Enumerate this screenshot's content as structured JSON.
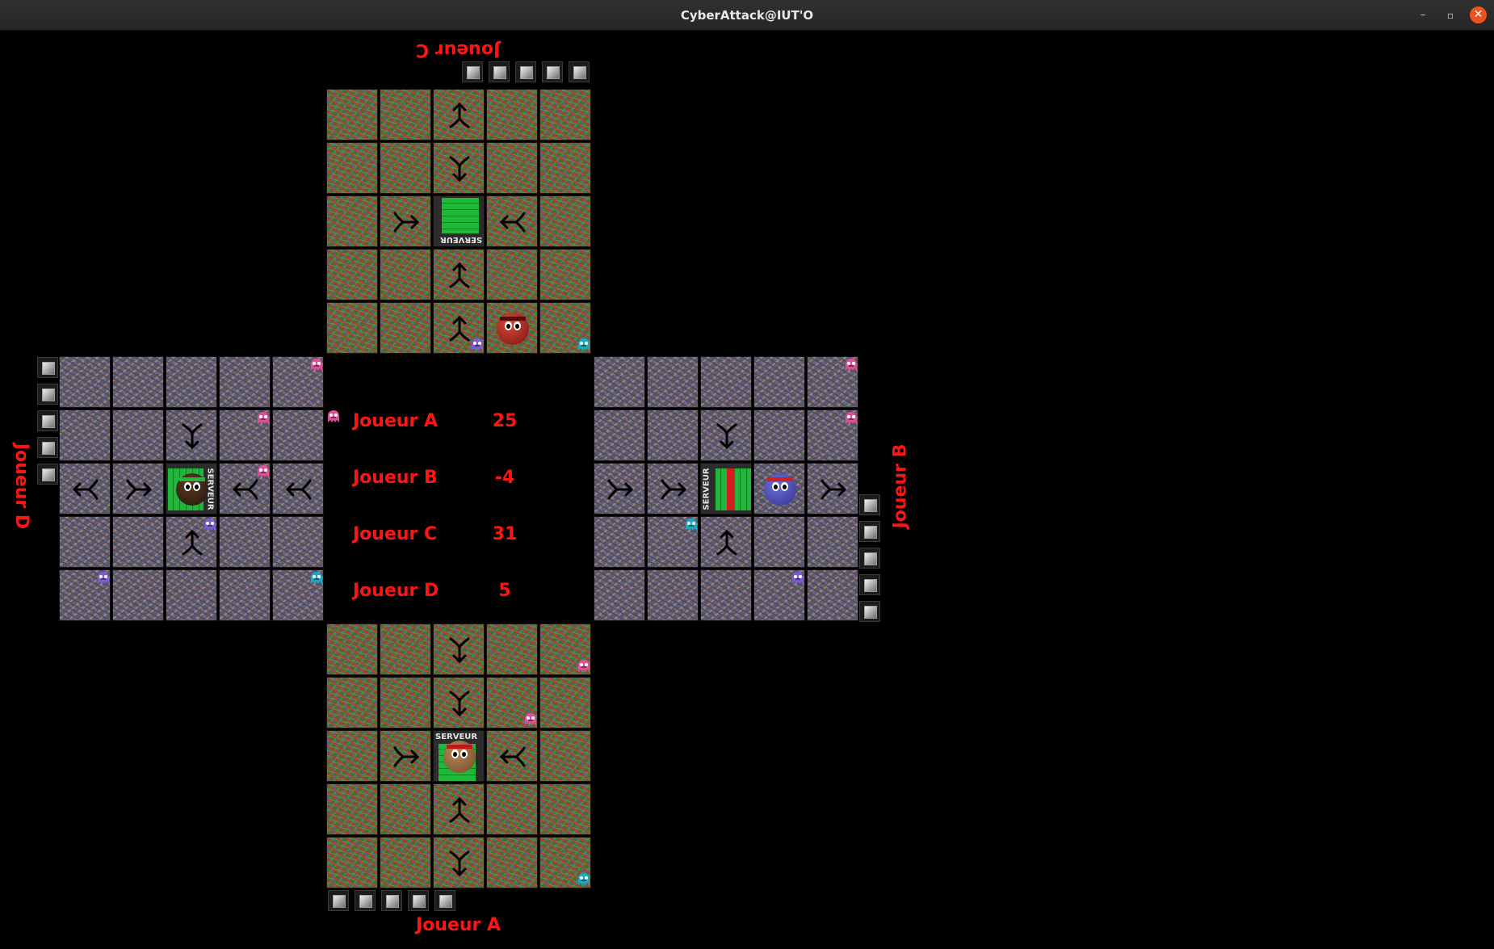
{
  "window": {
    "title": "CyberAttack@IUT'O",
    "controls": [
      "–",
      "▫",
      "✕"
    ]
  },
  "players": {
    "A": {
      "label": "Joueur A",
      "score": "25",
      "color": "#ff1414"
    },
    "B": {
      "label": "Joueur B",
      "score": "-4",
      "color": "#ff1414"
    },
    "C": {
      "label": "Joueur C",
      "score": "31",
      "color": "#ff1414"
    },
    "D": {
      "label": "Joueur D",
      "score": "5",
      "color": "#ff1414"
    }
  },
  "scoreboard": [
    {
      "name": "Joueur A",
      "score": "25"
    },
    {
      "name": "Joueur B",
      "score": "-4"
    },
    {
      "name": "Joueur C",
      "score": "31"
    },
    {
      "name": "Joueur D",
      "score": "5"
    }
  ],
  "server_caption": "SERVEUR",
  "colors": {
    "label_red": "#ff1414",
    "server_green": "#1fb83a",
    "server_red": "#d42020",
    "bug_pink": "#e0509a",
    "bug_purple": "#7d5ad6",
    "bug_cyan": "#1ba8c4",
    "close_button": "#e95420"
  },
  "boards": {
    "A": {
      "arrows": [
        [
          "-",
          "-",
          "down",
          "-",
          "-"
        ],
        [
          "-",
          "-",
          "down",
          "-",
          "-"
        ],
        [
          "-",
          "right",
          "server",
          "left",
          "-"
        ],
        [
          "-",
          "-",
          "up",
          "-",
          "-"
        ],
        [
          "-",
          "-",
          "down",
          "-",
          "-"
        ]
      ],
      "server_fill": "full",
      "pawn": "A",
      "bugs": [
        {
          "row": 0,
          "col": 4,
          "color": "pink"
        },
        {
          "row": 1,
          "col": 3,
          "color": "pink"
        },
        {
          "row": 4,
          "col": 4,
          "color": "cyan"
        }
      ],
      "slots": 5
    },
    "B": {
      "arrows": [
        [
          "-",
          "-",
          "-",
          "-",
          "-"
        ],
        [
          "-",
          "-",
          "down",
          "-",
          "-"
        ],
        [
          "right",
          "right",
          "server",
          "pawn",
          "right"
        ],
        [
          "-",
          "-",
          "up",
          "-",
          "-"
        ],
        [
          "-",
          "-",
          "-",
          "-",
          "-"
        ]
      ],
      "server_fill": "partial",
      "pawn": "B",
      "bugs": [
        {
          "row": 0,
          "col": 4,
          "color": "pink"
        },
        {
          "row": 1,
          "col": 4,
          "color": "pink"
        },
        {
          "row": 3,
          "col": 1,
          "color": "cyan"
        },
        {
          "row": 4,
          "col": 3,
          "color": "purple"
        }
      ],
      "slots": 5
    },
    "C": {
      "arrows": [
        [
          "-",
          "-",
          "up",
          "-",
          "-"
        ],
        [
          "-",
          "-",
          "down",
          "-",
          "-"
        ],
        [
          "-",
          "right",
          "server",
          "left",
          "-"
        ],
        [
          "-",
          "-",
          "up",
          "-",
          "-"
        ],
        [
          "-",
          "-",
          "up",
          "pawn",
          "-"
        ]
      ],
      "server_fill": "full",
      "pawn": "C",
      "bugs": [
        {
          "row": 4,
          "col": 2,
          "color": "purple"
        },
        {
          "row": 4,
          "col": 4,
          "color": "cyan"
        }
      ],
      "slots": 5
    },
    "D": {
      "arrows": [
        [
          "-",
          "-",
          "-",
          "-",
          "-"
        ],
        [
          "-",
          "-",
          "down",
          "-",
          "-"
        ],
        [
          "left",
          "right",
          "server",
          "left",
          "left"
        ],
        [
          "-",
          "-",
          "up",
          "-",
          "-"
        ],
        [
          "-",
          "-",
          "-",
          "-",
          "-"
        ]
      ],
      "server_fill": "full",
      "pawn": "D",
      "bugs": [
        {
          "row": 0,
          "col": 4,
          "color": "pink"
        },
        {
          "row": 1,
          "col": 3,
          "color": "pink"
        },
        {
          "row": 2,
          "col": 3,
          "color": "pink"
        },
        {
          "row": 3,
          "col": 2,
          "color": "purple"
        },
        {
          "row": 4,
          "col": 0,
          "color": "purple"
        },
        {
          "row": 4,
          "col": 4,
          "color": "cyan"
        }
      ],
      "slots": 5
    }
  },
  "center_bug": {
    "color": "pink"
  }
}
